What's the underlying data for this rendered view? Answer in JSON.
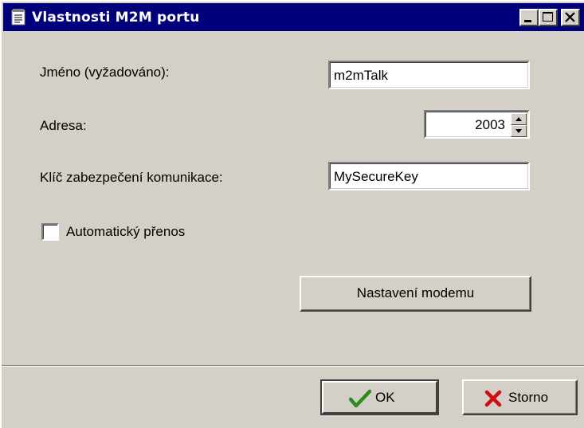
{
  "window": {
    "title": "Vlastnosti M2M portu",
    "icon": "notepad-icon",
    "controls": [
      "minimize-icon",
      "maximize-icon",
      "close-icon"
    ]
  },
  "form": {
    "name_label": "Jméno (vyžadováno):",
    "name_value": "m2mTalk",
    "address_label": "Adresa:",
    "address_value": "2003",
    "key_label": "Klíč zabezpečení komunikace:",
    "key_value": "MySecureKey",
    "auto_transfer_label": "Automatický přenos",
    "auto_transfer_checked": false,
    "modem_button_label": "Nastavení modemu"
  },
  "footer": {
    "ok_label": "OK",
    "ok_icon": "checkmark-icon",
    "cancel_label": "Storno",
    "cancel_icon": "red-x-icon"
  },
  "colors": {
    "titlebar": "#00007b",
    "face": "#d4d0c8",
    "ok_check": "#2e8b1e",
    "cancel_x": "#d01010"
  }
}
